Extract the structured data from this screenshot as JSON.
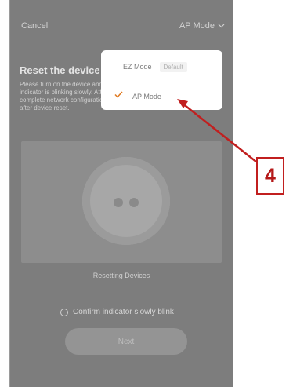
{
  "topbar": {
    "cancel_label": "Cancel",
    "mode_label": "AP Mode"
  },
  "content": {
    "title": "Reset the device",
    "description": "Please turn on the device and confirm that the indicator is blinking slowly. Attention: please complete network configuration within 3 minutes after device reset.",
    "illustration_caption": "Resetting Devices",
    "confirm_label": "Confirm indicator slowly blink",
    "next_label": "Next"
  },
  "dropdown": {
    "items": [
      {
        "label": "EZ Mode",
        "badge": "Default",
        "selected": false
      },
      {
        "label": "AP Mode",
        "badge": "",
        "selected": true
      }
    ]
  },
  "annotation": {
    "step_number": "4",
    "color": "#c11f1f"
  },
  "colors": {
    "overlay": "#7d7d7d",
    "accent": "#e07a22",
    "dropdown_bg": "#ffffff"
  }
}
